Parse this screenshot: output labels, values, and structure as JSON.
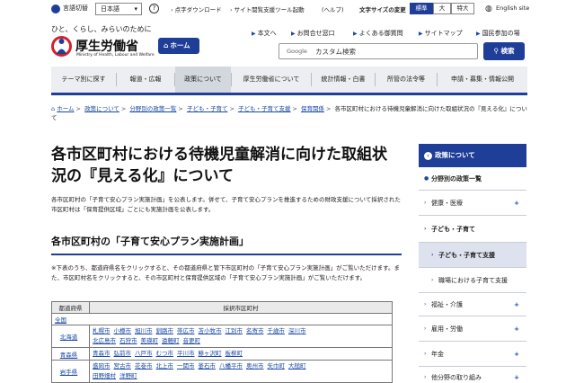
{
  "utility": {
    "language_label": "言語切替",
    "language_value": "日本語",
    "help_icon": "?",
    "links": [
      {
        "label": "点字ダウンロード"
      },
      {
        "label": "サイト閲覧支援ツール起動"
      },
      {
        "label": "(ヘルプ)"
      }
    ],
    "font_size_label": "文字サイズの変更",
    "font_sizes": [
      "標準",
      "大",
      "特大"
    ],
    "english_label": "English site"
  },
  "header": {
    "tagline": "ひと、くらし、みらいのために",
    "logo_name": "厚生労働省",
    "logo_en": "Ministry of Health, Labour and Welfare",
    "home_button": "ホーム",
    "links": [
      "本文へ",
      "お問合せ窓口",
      "よくある御質問",
      "サイトマップ",
      "国民参加の場"
    ],
    "search_google": "Google",
    "search_placeholder": "カスタム検索",
    "search_button": "検索"
  },
  "gnav": [
    "テーマ別に探す",
    "報道・広報",
    "政策について",
    "厚生労働省について",
    "統計情報・白書",
    "所管の法令等",
    "申請・募集・情報公開"
  ],
  "breadcrumb": {
    "items": [
      "ホーム",
      "政策について",
      "分野別の政策一覧",
      "子ども・子育て",
      "子ども・子育て支援",
      "保育関係"
    ],
    "current": "各市区町村における待機児童解消に向けた取組状況の『見える化』について"
  },
  "main": {
    "title": "各市区町村における待機児童解消に向けた取組状況の『見える化』について",
    "lead": "各市区町村の「子育て安心プラン実施計画」を公表します。併せて、子育て安心プランを推進するための財政支援について採択された市区町村は「保育提供区域」ごとにも実施計画を公表します。",
    "h2": "各市区町村の「子育て安心プラン実施計画」",
    "note": "※下表のうち、都道府県名をクリックすると、その都道府県と管下市区町村の「子育て安心プラン実施計画」がご覧いただけます。また、市区町村名をクリックすると、その市区町村と保育提供区域の「子育て安心プラン実施計画」がご覧いただけます。"
  },
  "table": {
    "headers": [
      "都道府県",
      "採択市区町村"
    ],
    "all_label": "全国",
    "rows": [
      {
        "pref": "北海道",
        "lines": [
          [
            "札幌市",
            "小樽市",
            "旭川市",
            "釧路市",
            "帯広市",
            "苫小牧市",
            "江別市",
            "名寄市",
            "千歳市",
            "深川市"
          ],
          [
            "北広島市",
            "石狩市",
            "美瑛町",
            "遠軽町",
            "音更町"
          ]
        ]
      },
      {
        "pref": "青森県",
        "lines": [
          [
            "青森市",
            "弘前市",
            "八戸市",
            "むつ市",
            "平川市",
            "鰺ヶ沢町",
            "板柳町"
          ]
        ]
      },
      {
        "pref": "岩手県",
        "lines": [
          [
            "盛岡市",
            "宮古市",
            "花巻市",
            "北上市",
            "一関市",
            "釜石市",
            "八幡平市",
            "奥州市",
            "矢巾町",
            "大槌町"
          ],
          [
            "田野畑村",
            "洋野町"
          ]
        ]
      }
    ]
  },
  "side": {
    "head": "政策について",
    "items": [
      {
        "label": "分野別の政策一覧",
        "level": 1,
        "style": "bold"
      },
      {
        "label": "健康・医療",
        "level": 1,
        "style": "plus"
      },
      {
        "label": "子ども・子育て",
        "level": 1,
        "style": "bold"
      },
      {
        "label": "子ども・子育て支援",
        "level": 2,
        "style": "cur"
      },
      {
        "label": "職場における子育て支援",
        "level": 2,
        "style": "plain"
      },
      {
        "label": "福祉・介護",
        "level": 1,
        "style": "plus"
      },
      {
        "label": "雇用・労働",
        "level": 1,
        "style": "plus"
      },
      {
        "label": "年金",
        "level": 1,
        "style": "plus"
      },
      {
        "label": "他分野の取り組み",
        "level": 1,
        "style": "plus"
      }
    ]
  },
  "colors": {
    "brand": "#1f3e98",
    "logo_red": "#d71f2a"
  }
}
